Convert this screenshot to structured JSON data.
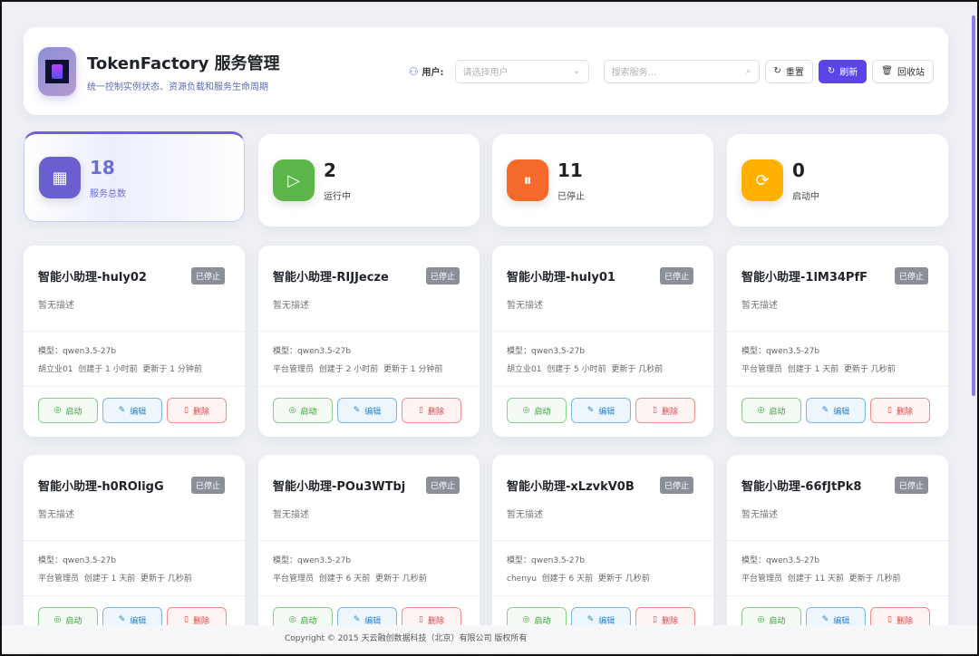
{
  "header": {
    "title": "TokenFactory 服务管理",
    "subtitle": "统一控制实例状态、资源负载和服务生命周期",
    "user_label": "用户:",
    "user_placeholder": "请选择用户",
    "search_placeholder": "搜索服务...",
    "reset": "重置",
    "refresh": "刷新",
    "recycle": "回收站"
  },
  "stats": [
    {
      "value": "18",
      "label": "服务总数",
      "icon": "grid-icon",
      "color": "#6a5fd0"
    },
    {
      "value": "2",
      "label": "运行中",
      "icon": "play-circle-icon",
      "color": "#5cb548"
    },
    {
      "value": "11",
      "label": "已停止",
      "icon": "pause-circle-icon",
      "color": "#f56a2a"
    },
    {
      "value": "0",
      "label": "启动中",
      "icon": "refresh-icon",
      "color": "#ffb000"
    }
  ],
  "cards": [
    {
      "name": "智能小助理-huly02",
      "status": "已停止",
      "desc": "暂无描述",
      "model": "模型：qwen3.5-27b",
      "owner": "胡立业01",
      "created": "创建于 1 小时前",
      "updated": "更新于 1 分钟前"
    },
    {
      "name": "智能小助理-RIJJecze",
      "status": "已停止",
      "desc": "暂无描述",
      "model": "模型：qwen3.5-27b",
      "owner": "平台管理员",
      "created": "创建于 2 小时前",
      "updated": "更新于 1 分钟前"
    },
    {
      "name": "智能小助理-huly01",
      "status": "已停止",
      "desc": "暂无描述",
      "model": "模型：qwen3.5-27b",
      "owner": "胡立业01",
      "created": "创建于 5 小时前",
      "updated": "更新于 几秒前"
    },
    {
      "name": "智能小助理-1lM34PfF",
      "status": "已停止",
      "desc": "暂无描述",
      "model": "模型：qwen3.5-27b",
      "owner": "平台管理员",
      "created": "创建于 1 天前",
      "updated": "更新于 几秒前"
    },
    {
      "name": "智能小助理-h0ROligG",
      "status": "已停止",
      "desc": "暂无描述",
      "model": "模型：qwen3.5-27b",
      "owner": "平台管理员",
      "created": "创建于 1 天前",
      "updated": "更新于 几秒前"
    },
    {
      "name": "智能小助理-POu3WTbj",
      "status": "已停止",
      "desc": "暂无描述",
      "model": "模型：qwen3.5-27b",
      "owner": "平台管理员",
      "created": "创建于 6 天前",
      "updated": "更新于 几秒前"
    },
    {
      "name": "智能小助理-xLzvkV0B",
      "status": "已停止",
      "desc": "暂无描述",
      "model": "模型：qwen3.5-27b",
      "owner": "chenyu",
      "created": "创建于 6 天前",
      "updated": "更新于 几秒前"
    },
    {
      "name": "智能小助理-66fJtPk8",
      "status": "已停止",
      "desc": "暂无描述",
      "model": "模型：qwen3.5-27b",
      "owner": "平台管理员",
      "created": "创建于 11 天前",
      "updated": "更新于 几秒前"
    }
  ],
  "card_actions": {
    "start": "启动",
    "edit": "编辑",
    "delete": "删除"
  },
  "footer": "Copyright © 2015 天云融创数据科技（北京）有限公司 版权所有"
}
